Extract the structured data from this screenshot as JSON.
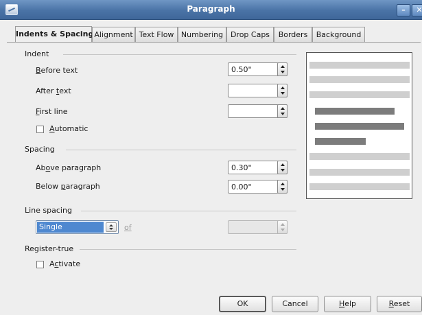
{
  "window": {
    "title": "Paragraph"
  },
  "tabs": [
    {
      "label": "Indents & Spacing",
      "active": true
    },
    {
      "label": "Alignment"
    },
    {
      "label": "Text Flow"
    },
    {
      "label": "Numbering"
    },
    {
      "label": "Drop Caps"
    },
    {
      "label": "Borders"
    },
    {
      "label": "Background"
    }
  ],
  "indent": {
    "section_label": "Indent",
    "before_text": {
      "mnemonic": "B",
      "rest": "efore text",
      "value": "0.50\""
    },
    "after_text": {
      "prefix": "After ",
      "mnemonic": "t",
      "rest": "ext",
      "value": ""
    },
    "first_line": {
      "mnemonic": "F",
      "rest": "irst line",
      "value": ""
    },
    "automatic": {
      "mnemonic": "A",
      "rest": "utomatic",
      "checked": false
    }
  },
  "spacing": {
    "section_label": "Spacing",
    "above_paragraph": {
      "prefix": "Ab",
      "mnemonic": "o",
      "rest": "ve paragraph",
      "value": "0.30\""
    },
    "below_paragraph": {
      "prefix": "Below ",
      "mnemonic": "p",
      "rest": "aragraph",
      "value": "0.00\""
    }
  },
  "line_spacing": {
    "section_label": "Line spacing",
    "selected": "Single",
    "of_label": "of",
    "of_value": ""
  },
  "register_true": {
    "section_label": "Register-true",
    "activate": {
      "prefix": "A",
      "mnemonic": "c",
      "rest": "tivate",
      "checked": false
    }
  },
  "buttons": {
    "ok": "OK",
    "cancel": "Cancel",
    "help": {
      "mnemonic": "H",
      "rest": "elp"
    },
    "reset": {
      "mnemonic": "R",
      "rest": "eset"
    }
  },
  "icons": {
    "app": "paragraph-dialog-icon",
    "minimize": "minimize-icon",
    "close": "close-icon"
  },
  "colors": {
    "titlebar": "#4a73a6",
    "selection": "#4e88d0",
    "preview_light": "#cfcfcf",
    "preview_dark": "#7c7c7c"
  }
}
